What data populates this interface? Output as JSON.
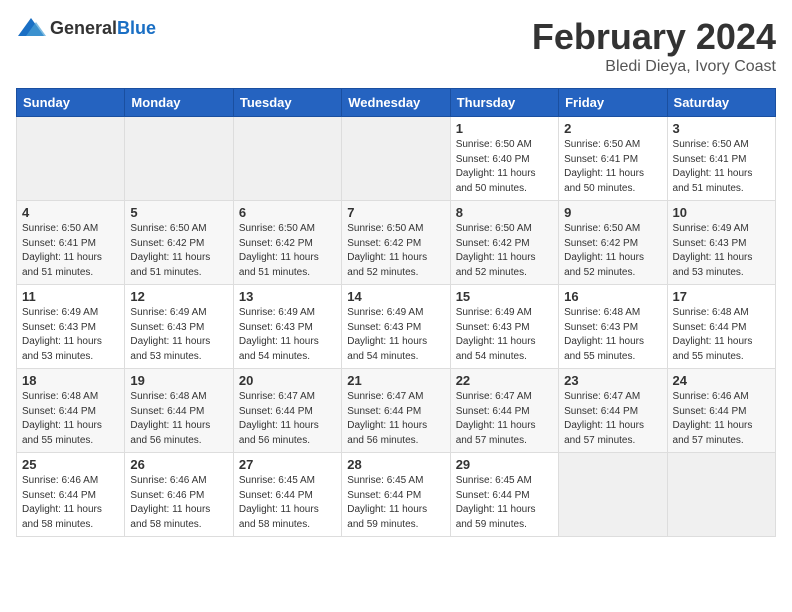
{
  "header": {
    "logo_general": "General",
    "logo_blue": "Blue",
    "month_year": "February 2024",
    "location": "Bledi Dieya, Ivory Coast"
  },
  "weekdays": [
    "Sunday",
    "Monday",
    "Tuesday",
    "Wednesday",
    "Thursday",
    "Friday",
    "Saturday"
  ],
  "weeks": [
    [
      {
        "day": "",
        "sunrise": "",
        "sunset": "",
        "daylight": ""
      },
      {
        "day": "",
        "sunrise": "",
        "sunset": "",
        "daylight": ""
      },
      {
        "day": "",
        "sunrise": "",
        "sunset": "",
        "daylight": ""
      },
      {
        "day": "",
        "sunrise": "",
        "sunset": "",
        "daylight": ""
      },
      {
        "day": "1",
        "sunrise": "Sunrise: 6:50 AM",
        "sunset": "Sunset: 6:40 PM",
        "daylight": "Daylight: 11 hours and 50 minutes."
      },
      {
        "day": "2",
        "sunrise": "Sunrise: 6:50 AM",
        "sunset": "Sunset: 6:41 PM",
        "daylight": "Daylight: 11 hours and 50 minutes."
      },
      {
        "day": "3",
        "sunrise": "Sunrise: 6:50 AM",
        "sunset": "Sunset: 6:41 PM",
        "daylight": "Daylight: 11 hours and 51 minutes."
      }
    ],
    [
      {
        "day": "4",
        "sunrise": "Sunrise: 6:50 AM",
        "sunset": "Sunset: 6:41 PM",
        "daylight": "Daylight: 11 hours and 51 minutes."
      },
      {
        "day": "5",
        "sunrise": "Sunrise: 6:50 AM",
        "sunset": "Sunset: 6:42 PM",
        "daylight": "Daylight: 11 hours and 51 minutes."
      },
      {
        "day": "6",
        "sunrise": "Sunrise: 6:50 AM",
        "sunset": "Sunset: 6:42 PM",
        "daylight": "Daylight: 11 hours and 51 minutes."
      },
      {
        "day": "7",
        "sunrise": "Sunrise: 6:50 AM",
        "sunset": "Sunset: 6:42 PM",
        "daylight": "Daylight: 11 hours and 52 minutes."
      },
      {
        "day": "8",
        "sunrise": "Sunrise: 6:50 AM",
        "sunset": "Sunset: 6:42 PM",
        "daylight": "Daylight: 11 hours and 52 minutes."
      },
      {
        "day": "9",
        "sunrise": "Sunrise: 6:50 AM",
        "sunset": "Sunset: 6:42 PM",
        "daylight": "Daylight: 11 hours and 52 minutes."
      },
      {
        "day": "10",
        "sunrise": "Sunrise: 6:49 AM",
        "sunset": "Sunset: 6:43 PM",
        "daylight": "Daylight: 11 hours and 53 minutes."
      }
    ],
    [
      {
        "day": "11",
        "sunrise": "Sunrise: 6:49 AM",
        "sunset": "Sunset: 6:43 PM",
        "daylight": "Daylight: 11 hours and 53 minutes."
      },
      {
        "day": "12",
        "sunrise": "Sunrise: 6:49 AM",
        "sunset": "Sunset: 6:43 PM",
        "daylight": "Daylight: 11 hours and 53 minutes."
      },
      {
        "day": "13",
        "sunrise": "Sunrise: 6:49 AM",
        "sunset": "Sunset: 6:43 PM",
        "daylight": "Daylight: 11 hours and 54 minutes."
      },
      {
        "day": "14",
        "sunrise": "Sunrise: 6:49 AM",
        "sunset": "Sunset: 6:43 PM",
        "daylight": "Daylight: 11 hours and 54 minutes."
      },
      {
        "day": "15",
        "sunrise": "Sunrise: 6:49 AM",
        "sunset": "Sunset: 6:43 PM",
        "daylight": "Daylight: 11 hours and 54 minutes."
      },
      {
        "day": "16",
        "sunrise": "Sunrise: 6:48 AM",
        "sunset": "Sunset: 6:43 PM",
        "daylight": "Daylight: 11 hours and 55 minutes."
      },
      {
        "day": "17",
        "sunrise": "Sunrise: 6:48 AM",
        "sunset": "Sunset: 6:44 PM",
        "daylight": "Daylight: 11 hours and 55 minutes."
      }
    ],
    [
      {
        "day": "18",
        "sunrise": "Sunrise: 6:48 AM",
        "sunset": "Sunset: 6:44 PM",
        "daylight": "Daylight: 11 hours and 55 minutes."
      },
      {
        "day": "19",
        "sunrise": "Sunrise: 6:48 AM",
        "sunset": "Sunset: 6:44 PM",
        "daylight": "Daylight: 11 hours and 56 minutes."
      },
      {
        "day": "20",
        "sunrise": "Sunrise: 6:47 AM",
        "sunset": "Sunset: 6:44 PM",
        "daylight": "Daylight: 11 hours and 56 minutes."
      },
      {
        "day": "21",
        "sunrise": "Sunrise: 6:47 AM",
        "sunset": "Sunset: 6:44 PM",
        "daylight": "Daylight: 11 hours and 56 minutes."
      },
      {
        "day": "22",
        "sunrise": "Sunrise: 6:47 AM",
        "sunset": "Sunset: 6:44 PM",
        "daylight": "Daylight: 11 hours and 57 minutes."
      },
      {
        "day": "23",
        "sunrise": "Sunrise: 6:47 AM",
        "sunset": "Sunset: 6:44 PM",
        "daylight": "Daylight: 11 hours and 57 minutes."
      },
      {
        "day": "24",
        "sunrise": "Sunrise: 6:46 AM",
        "sunset": "Sunset: 6:44 PM",
        "daylight": "Daylight: 11 hours and 57 minutes."
      }
    ],
    [
      {
        "day": "25",
        "sunrise": "Sunrise: 6:46 AM",
        "sunset": "Sunset: 6:44 PM",
        "daylight": "Daylight: 11 hours and 58 minutes."
      },
      {
        "day": "26",
        "sunrise": "Sunrise: 6:46 AM",
        "sunset": "Sunset: 6:46 PM",
        "daylight": "Daylight: 11 hours and 58 minutes."
      },
      {
        "day": "27",
        "sunrise": "Sunrise: 6:45 AM",
        "sunset": "Sunset: 6:44 PM",
        "daylight": "Daylight: 11 hours and 58 minutes."
      },
      {
        "day": "28",
        "sunrise": "Sunrise: 6:45 AM",
        "sunset": "Sunset: 6:44 PM",
        "daylight": "Daylight: 11 hours and 59 minutes."
      },
      {
        "day": "29",
        "sunrise": "Sunrise: 6:45 AM",
        "sunset": "Sunset: 6:44 PM",
        "daylight": "Daylight: 11 hours and 59 minutes."
      },
      {
        "day": "",
        "sunrise": "",
        "sunset": "",
        "daylight": ""
      },
      {
        "day": "",
        "sunrise": "",
        "sunset": "",
        "daylight": ""
      }
    ]
  ]
}
